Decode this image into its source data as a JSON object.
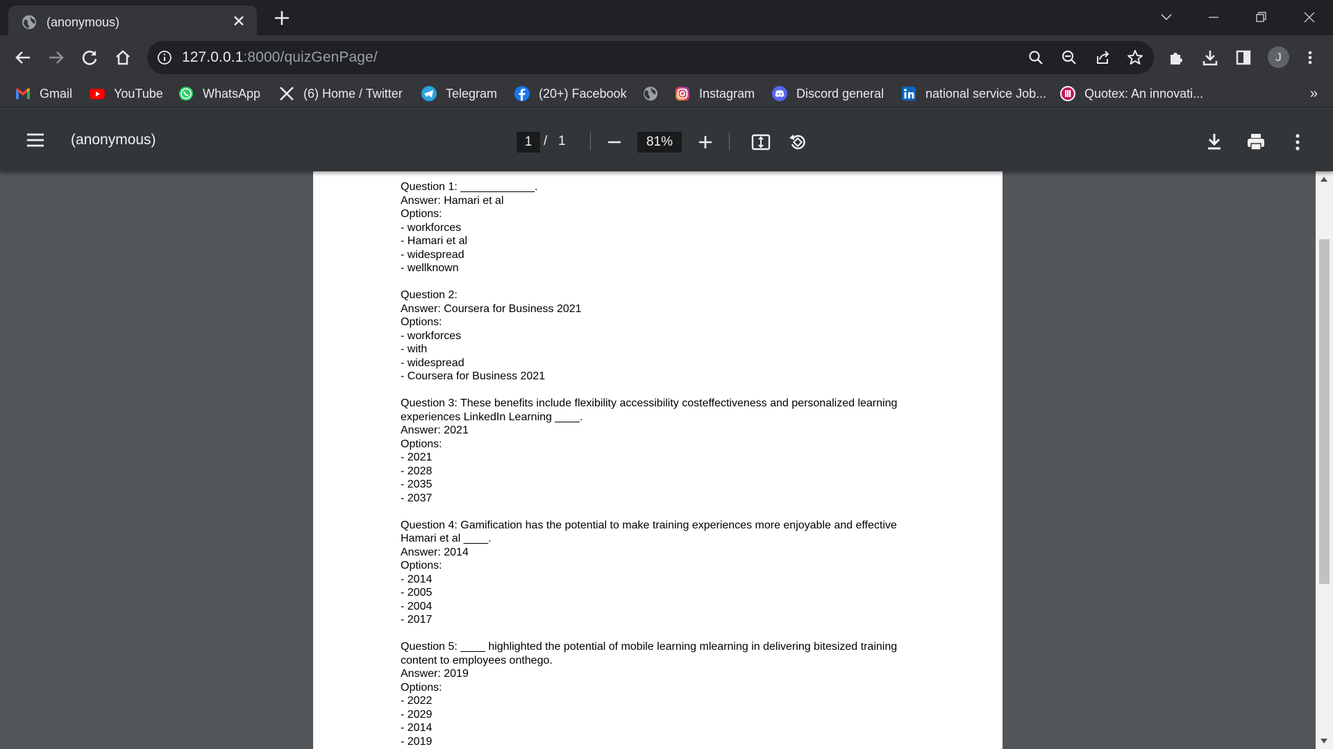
{
  "browser": {
    "tab": {
      "title": "(anonymous)",
      "favicon": "globe-icon"
    },
    "address_bar": {
      "host": "127.0.0.1",
      "path": ":8000/quizGenPage/"
    },
    "profile_initial": "J"
  },
  "bookmarks": [
    {
      "label": "Gmail",
      "icon": "gmail-icon"
    },
    {
      "label": "YouTube",
      "icon": "youtube-icon"
    },
    {
      "label": "WhatsApp",
      "icon": "whatsapp-icon"
    },
    {
      "label": "(6) Home / Twitter",
      "icon": "x-icon"
    },
    {
      "label": "Telegram",
      "icon": "telegram-icon"
    },
    {
      "label": "(20+) Facebook",
      "icon": "facebook-icon"
    },
    {
      "label": "",
      "icon": "globe-icon"
    },
    {
      "label": "Instagram",
      "icon": "instagram-icon"
    },
    {
      "label": "Discord general",
      "icon": "discord-icon"
    },
    {
      "label": "national service Job...",
      "icon": "linkedin-icon"
    },
    {
      "label": "Quotex: An innovati...",
      "icon": "quotex-icon"
    }
  ],
  "bookmarks_overflow": "»",
  "pdf_viewer": {
    "title": "(anonymous)",
    "current_page": "1",
    "separator": "/",
    "total_pages": "1",
    "zoom": "81%"
  },
  "document": {
    "questions": [
      {
        "question": "Question 1: ____________.",
        "answer": "Answer: Hamari et al",
        "options_label": "Options:",
        "options": [
          "- workforces",
          "- Hamari et al",
          "- widespread",
          "- wellknown"
        ]
      },
      {
        "question": "Question 2:",
        "answer": "Answer: Coursera for Business 2021",
        "options_label": "Options:",
        "options": [
          "- workforces",
          "- with",
          "- widespread",
          "- Coursera for Business 2021"
        ]
      },
      {
        "question": "Question 3: These benefits include flexibility accessibility costeffectiveness and personalized learning experiences LinkedIn Learning ____.",
        "answer": "Answer: 2021",
        "options_label": "Options:",
        "options": [
          "- 2021",
          "- 2028",
          "- 2035",
          "- 2037"
        ]
      },
      {
        "question": "Question 4: Gamification has the potential to make training experiences more enjoyable and effective Hamari et al ____.",
        "answer": "Answer: 2014",
        "options_label": "Options:",
        "options": [
          "- 2014",
          "- 2005",
          "- 2004",
          "- 2017"
        ]
      },
      {
        "question": "Question 5: ____ highlighted the potential of mobile learning mlearning in delivering bitesized training content to employees onthego.",
        "answer": "Answer: 2019",
        "options_label": "Options:",
        "options": [
          "- 2022",
          "- 2029",
          "- 2014",
          "- 2019"
        ]
      }
    ]
  }
}
